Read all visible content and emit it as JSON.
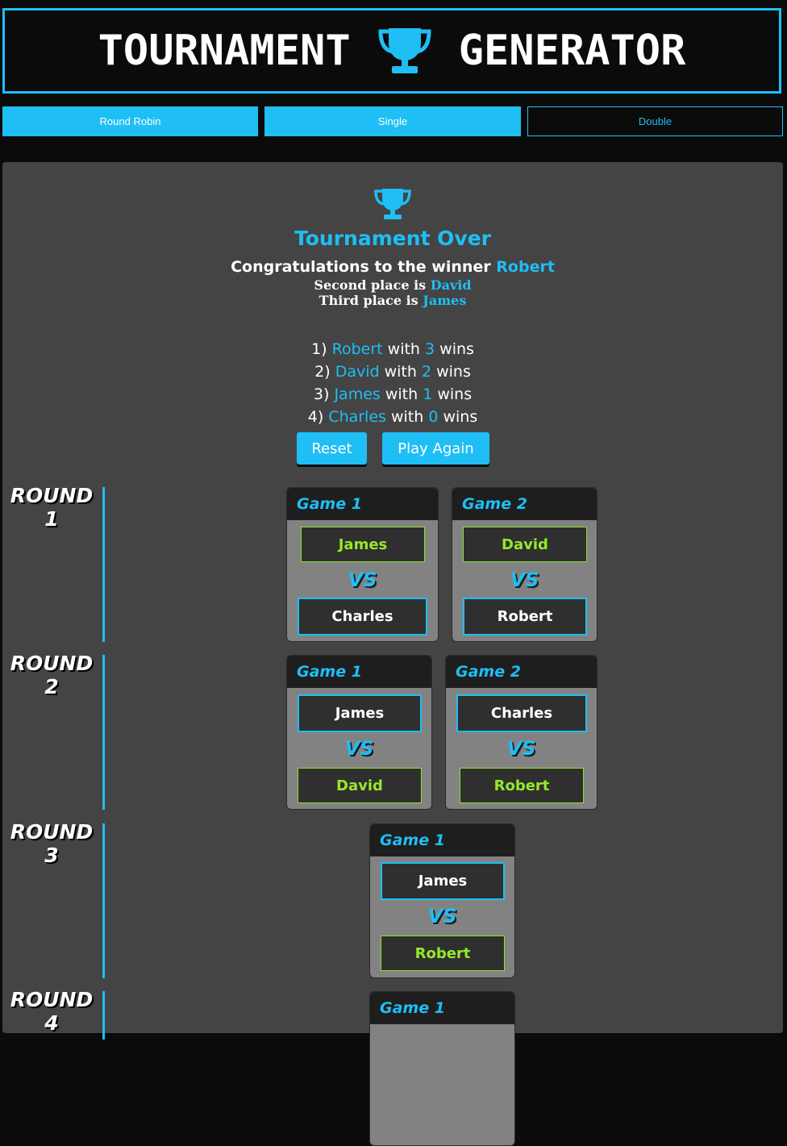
{
  "header": {
    "word_left": "TOURNAMENT",
    "word_right": "GENERATOR",
    "icon": "trophy-icon"
  },
  "modes": [
    {
      "label": "Round Robin",
      "style": "filled"
    },
    {
      "label": "Single",
      "style": "filled"
    },
    {
      "label": "Double",
      "style": "outline"
    }
  ],
  "result": {
    "title": "Tournament Over",
    "congrats_prefix": "Congratulations to the winner",
    "winner": "Robert",
    "second_prefix": "Second place is",
    "second": "David",
    "third_prefix": "Third place is",
    "third": "James",
    "standings": [
      {
        "rank": "1)",
        "name": "Robert",
        "with": "with",
        "wins": "3",
        "suffix": "wins"
      },
      {
        "rank": "2)",
        "name": "David",
        "with": "with",
        "wins": "2",
        "suffix": "wins"
      },
      {
        "rank": "3)",
        "name": "James",
        "with": "with",
        "wins": "1",
        "suffix": "wins"
      },
      {
        "rank": "4)",
        "name": "Charles",
        "with": "with",
        "wins": "0",
        "suffix": "wins"
      }
    ],
    "reset_label": "Reset",
    "play_again_label": "Play Again"
  },
  "vs_label": "VS",
  "rounds": [
    {
      "word": "ROUND",
      "number": "1",
      "games": [
        {
          "title": "Game 1",
          "top": "James",
          "bottom": "Charles",
          "winner": "top"
        },
        {
          "title": "Game 2",
          "top": "David",
          "bottom": "Robert",
          "winner": "top"
        }
      ]
    },
    {
      "word": "ROUND",
      "number": "2",
      "games": [
        {
          "title": "Game 1",
          "top": "James",
          "bottom": "David",
          "winner": "bottom"
        },
        {
          "title": "Game 2",
          "top": "Charles",
          "bottom": "Robert",
          "winner": "bottom"
        }
      ]
    },
    {
      "word": "ROUND",
      "number": "3",
      "games": [
        {
          "title": "Game 1",
          "top": "James",
          "bottom": "Robert",
          "winner": "bottom"
        }
      ]
    },
    {
      "word": "ROUND",
      "number": "4",
      "games": [
        {
          "title": "Game 1"
        }
      ]
    }
  ],
  "colors": {
    "accent": "#1fbef5",
    "winner": "#96e82a",
    "panel": "#444444",
    "background": "#0b0b0b"
  }
}
